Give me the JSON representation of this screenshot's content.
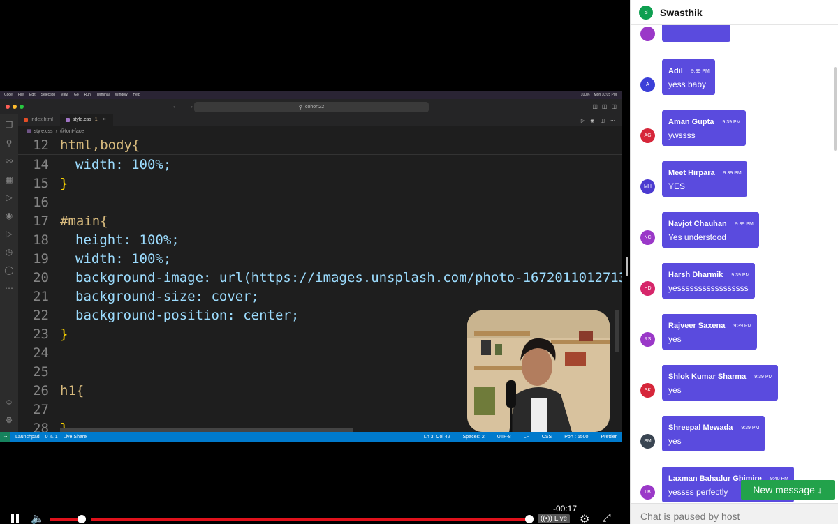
{
  "mac_menu": {
    "items": [
      "Code",
      "File",
      "Edit",
      "Selection",
      "View",
      "Go",
      "Run",
      "Terminal",
      "Window",
      "Help"
    ],
    "battery": "100%",
    "datetime": "Mon 10:05 PM"
  },
  "vscode": {
    "search_box": "cohort22",
    "tabs": [
      {
        "label": "index.html",
        "modified": ""
      },
      {
        "label": "style.css",
        "modified": "1"
      }
    ],
    "breadcrumb": {
      "file": "style.css",
      "symbol": "@font-face"
    },
    "sticky_line": {
      "num": "12",
      "text": "html,body{"
    },
    "lines": [
      {
        "num": "14",
        "text": "width: 100%;"
      },
      {
        "num": "15",
        "text": "}"
      },
      {
        "num": "16",
        "text": ""
      },
      {
        "num": "17",
        "text": "#main{"
      },
      {
        "num": "18",
        "text": "height: 100%;"
      },
      {
        "num": "19",
        "text": "width: 100%;"
      },
      {
        "num": "20",
        "text": "background-image: url(https://images.unsplash.com/photo-1672011012713-("
      },
      {
        "num": "21",
        "text": "background-size: cover;"
      },
      {
        "num": "22",
        "text": "background-position: center;"
      },
      {
        "num": "23",
        "text": "}"
      },
      {
        "num": "24",
        "text": ""
      },
      {
        "num": "25",
        "text": ""
      },
      {
        "num": "26",
        "text": "h1{"
      },
      {
        "num": "27",
        "text": ""
      },
      {
        "num": "28",
        "text": "}"
      }
    ],
    "status": {
      "launchpad": "Launchpad",
      "problems": "0 ⚠ 1",
      "live_share": "Live Share",
      "position": "Ln 3, Col 42",
      "spaces": "Spaces: 2",
      "encoding": "UTF-8",
      "eol": "LF",
      "language": "CSS",
      "port": "Port : 5500",
      "prettier": "Prettier"
    }
  },
  "player": {
    "time_remaining": "-00:17",
    "live_label": "Live",
    "volume_level": 0.85,
    "progress": 0.98
  },
  "chat": {
    "host_name": "Swasthik",
    "host_initial": "S",
    "messages": [
      {
        "initials": "A",
        "name": "Adil",
        "time": "9:39 PM",
        "text": "yess baby",
        "color": "#3b3fd8"
      },
      {
        "initials": "AG",
        "name": "Aman Gupta",
        "time": "9:39 PM",
        "text": "ywssss",
        "color": "#d6263a"
      },
      {
        "initials": "MH",
        "name": "Meet Hirpara",
        "time": "9:39 PM",
        "text": "YES",
        "color": "#4b3ad0"
      },
      {
        "initials": "NC",
        "name": "Navjot Chauhan",
        "time": "9:39 PM",
        "text": "Yes understood",
        "color": "#9a38c8"
      },
      {
        "initials": "HD",
        "name": "Harsh Dharmik",
        "time": "9:39 PM",
        "text": "yesssssssssssssssss",
        "color": "#d6266a"
      },
      {
        "initials": "RS",
        "name": "Rajveer Saxena",
        "time": "9:39 PM",
        "text": "yes",
        "color": "#9a38c8"
      },
      {
        "initials": "SK",
        "name": "Shlok Kumar Sharma",
        "time": "9:39 PM",
        "text": "yes",
        "color": "#d6263a"
      },
      {
        "initials": "SM",
        "name": "Shreepal Mewada",
        "time": "9:39 PM",
        "text": "yes",
        "color": "#3a4552"
      },
      {
        "initials": "LB",
        "name": "Laxman Bahadur Ghimire",
        "time": "9:40 PM",
        "text": "yessss perfectly",
        "color": "#9a38c8"
      }
    ],
    "new_message_label": "New message ↓",
    "input_placeholder": "Chat is paused by host"
  }
}
